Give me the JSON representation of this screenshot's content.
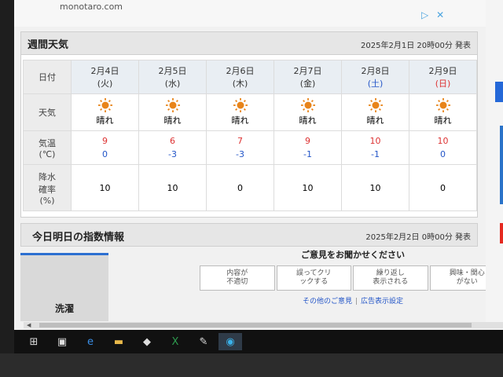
{
  "ad": {
    "url": "monotaro.com",
    "icons": [
      "ad-choices-icon",
      "close-icon"
    ]
  },
  "weekly": {
    "title": "週間天気",
    "issued": "2025年2月1日 20時00分 発表",
    "row_labels": {
      "date": "日付",
      "weather": "天気",
      "temp_line1": "気温",
      "temp_line2": "(℃)",
      "pop_line1": "降水",
      "pop_line2": "確率",
      "pop_line3": "(%)"
    },
    "days": [
      {
        "date": "2月4日",
        "dow": "(火)",
        "weather": "晴れ",
        "hi": "9",
        "lo": "0",
        "pop": "10"
      },
      {
        "date": "2月5日",
        "dow": "(水)",
        "weather": "晴れ",
        "hi": "6",
        "lo": "-3",
        "pop": "10"
      },
      {
        "date": "2月6日",
        "dow": "(木)",
        "weather": "晴れ",
        "hi": "7",
        "lo": "-3",
        "pop": "0"
      },
      {
        "date": "2月7日",
        "dow": "(金)",
        "weather": "晴れ",
        "hi": "9",
        "lo": "-1",
        "pop": "10"
      },
      {
        "date": "2月8日",
        "dow": "(土)",
        "weather": "晴れ",
        "hi": "10",
        "lo": "-1",
        "pop": "10"
      },
      {
        "date": "2月9日",
        "dow": "(日)",
        "weather": "晴れ",
        "hi": "10",
        "lo": "0",
        "pop": "0"
      }
    ]
  },
  "index": {
    "title": "今日明日の指数情報",
    "issued": "2025年2月2日 0時00分 発表",
    "card_label": "洗濯"
  },
  "feedback": {
    "title": "ご意見をお聞かせください",
    "buttons": [
      {
        "line1": "内容が",
        "line2": "不適切"
      },
      {
        "line1": "誤ってクリ",
        "line2": "ックする"
      },
      {
        "line1": "繰り返し",
        "line2": "表示される"
      },
      {
        "line1": "興味・関心",
        "line2": "がない"
      }
    ],
    "link_other": "その他のご意見",
    "link_settings": "広告表示設定"
  },
  "colors": {
    "hi": "#dd3333",
    "lo": "#2456c8",
    "sun": "#e8841a",
    "accent": "#2468d8"
  },
  "taskbar": {
    "icons": [
      "windows-start-icon",
      "file-explorer-icon",
      "internet-explorer-icon",
      "folder-icon",
      "app-icon",
      "excel-icon",
      "paint-icon",
      "edge-icon"
    ]
  }
}
